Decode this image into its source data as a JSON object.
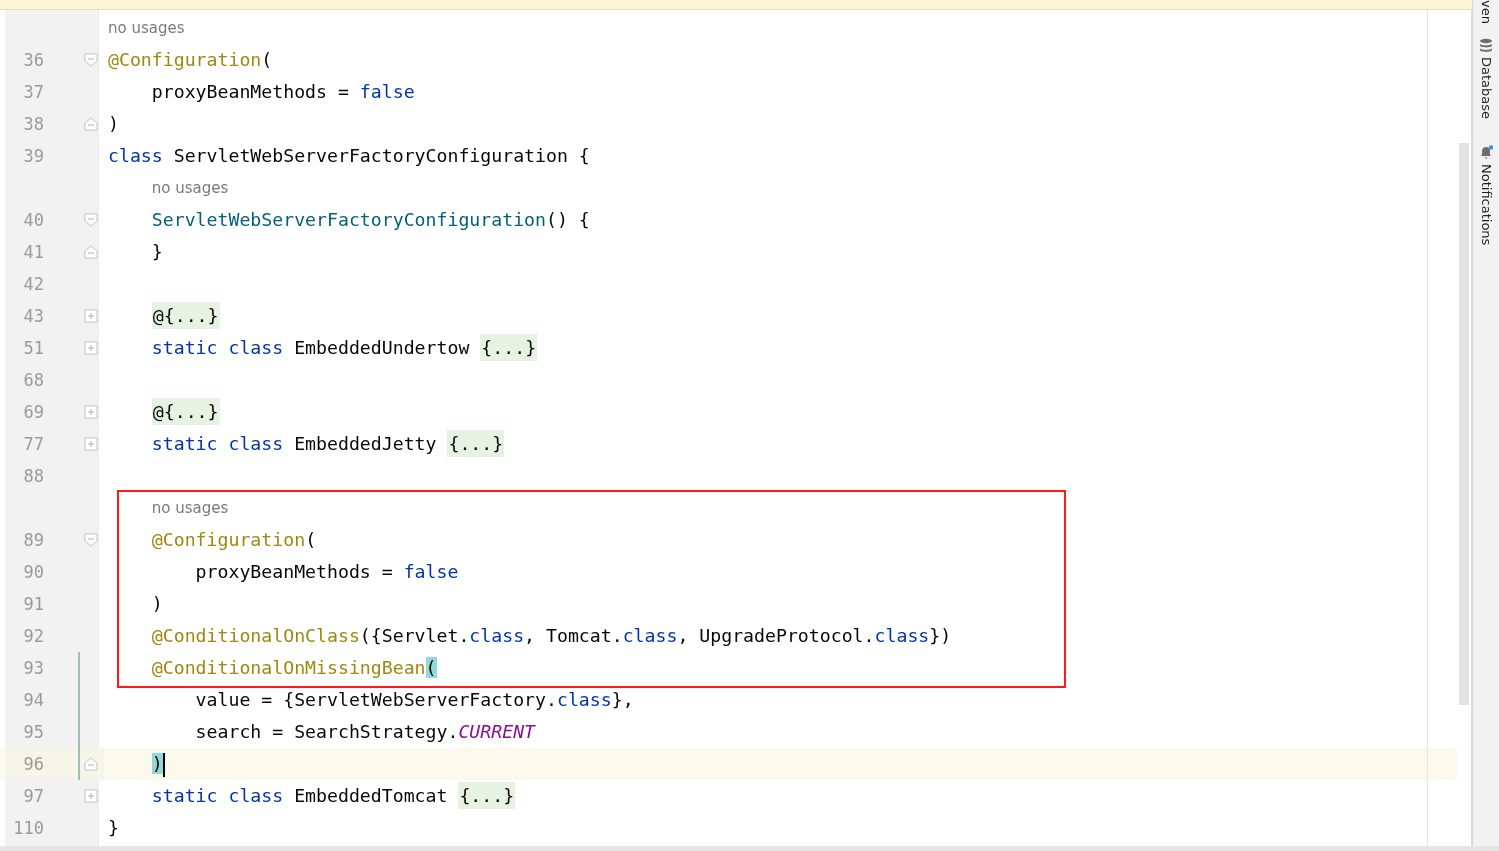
{
  "editor": {
    "lines": [
      {
        "number": "36",
        "fold_start": true,
        "hint": "no usages",
        "tokens": [
          {
            "kind": "annotation",
            "text": "@Configuration"
          },
          {
            "kind": "plain",
            "text": "("
          }
        ]
      },
      {
        "number": "37",
        "tokens": [
          {
            "kind": "plain",
            "text": "    proxyBeanMethods = "
          },
          {
            "kind": "keyword",
            "text": "false"
          }
        ]
      },
      {
        "number": "38",
        "fold_end": true,
        "tokens": [
          {
            "kind": "plain",
            "text": ")"
          }
        ]
      },
      {
        "number": "39",
        "tokens": [
          {
            "kind": "keyword",
            "text": "class"
          },
          {
            "kind": "plain",
            "text": " ServletWebServerFactoryConfiguration {"
          }
        ]
      },
      {
        "number": "40",
        "fold_start": true,
        "hint": "no usages",
        "tokens": [
          {
            "kind": "method",
            "text": "    ServletWebServerFactoryConfiguration"
          },
          {
            "kind": "plain",
            "text": "() {"
          }
        ]
      },
      {
        "number": "41",
        "fold_end": true,
        "tokens": [
          {
            "kind": "plain",
            "text": "    }"
          }
        ]
      },
      {
        "number": "42"
      },
      {
        "number": "43",
        "collapsed": true,
        "tokens": [
          {
            "kind": "folded",
            "text": "    @{...}"
          }
        ]
      },
      {
        "number": "51",
        "collapsed": true,
        "tokens": [
          {
            "kind": "keyword",
            "text": "    static class"
          },
          {
            "kind": "plain",
            "text": " EmbeddedUndertow "
          },
          {
            "kind": "folded",
            "text": "{...}"
          }
        ]
      },
      {
        "number": "68"
      },
      {
        "number": "69",
        "collapsed": true,
        "tokens": [
          {
            "kind": "folded",
            "text": "    @{...}"
          }
        ]
      },
      {
        "number": "77",
        "collapsed": true,
        "tokens": [
          {
            "kind": "keyword",
            "text": "    static class"
          },
          {
            "kind": "plain",
            "text": " EmbeddedJetty "
          },
          {
            "kind": "folded",
            "text": "{...}"
          }
        ]
      },
      {
        "number": "88"
      },
      {
        "number": "89",
        "fold_start": true,
        "framed": true,
        "hint": "no usages",
        "tokens": [
          {
            "kind": "annotation",
            "text": "    @Configuration"
          },
          {
            "kind": "plain",
            "text": "("
          }
        ]
      },
      {
        "number": "90",
        "framed": true,
        "tokens": [
          {
            "kind": "plain",
            "text": "        proxyBeanMethods = "
          },
          {
            "kind": "keyword",
            "text": "false"
          }
        ]
      },
      {
        "number": "91",
        "framed": true,
        "tokens": [
          {
            "kind": "plain",
            "text": "    )"
          }
        ]
      },
      {
        "number": "92",
        "framed": true,
        "tokens": [
          {
            "kind": "annotation",
            "text": "    @ConditionalOnClass"
          },
          {
            "kind": "plain",
            "text": "({Servlet."
          },
          {
            "kind": "keyword",
            "text": "class"
          },
          {
            "kind": "plain",
            "text": ", Tomcat."
          },
          {
            "kind": "keyword",
            "text": "class"
          },
          {
            "kind": "plain",
            "text": ", UpgradeProtocol."
          },
          {
            "kind": "keyword",
            "text": "class"
          },
          {
            "kind": "plain",
            "text": "})"
          }
        ]
      },
      {
        "number": "93",
        "framed": true,
        "changed": true,
        "tokens": [
          {
            "kind": "annotation",
            "text": "    @ConditionalOnMissingBean"
          },
          {
            "kind": "matched",
            "text": "("
          }
        ]
      },
      {
        "number": "94",
        "changed": true,
        "tokens": [
          {
            "kind": "plain",
            "text": "        value = {ServletWebServerFactory."
          },
          {
            "kind": "keyword",
            "text": "class"
          },
          {
            "kind": "plain",
            "text": "},"
          }
        ]
      },
      {
        "number": "95",
        "changed": true,
        "tokens": [
          {
            "kind": "plain",
            "text": "        search = SearchStrategy."
          },
          {
            "kind": "constant",
            "text": "CURRENT"
          }
        ]
      },
      {
        "number": "96",
        "fold_end": true,
        "changed": true,
        "current": true,
        "tokens": [
          {
            "kind": "matched",
            "text": "    )"
          }
        ]
      },
      {
        "number": "97",
        "collapsed": true,
        "tokens": [
          {
            "kind": "keyword",
            "text": "    static class"
          },
          {
            "kind": "plain",
            "text": " EmbeddedTomcat "
          },
          {
            "kind": "folded",
            "text": "{...}"
          }
        ]
      },
      {
        "number": "110",
        "tokens": [
          {
            "kind": "plain",
            "text": "}"
          }
        ]
      }
    ]
  },
  "tool_strip": [
    {
      "kind": "maven",
      "label": "ven"
    },
    {
      "kind": "database",
      "label": "Database"
    },
    {
      "kind": "notifications",
      "label": "Notifications"
    }
  ]
}
